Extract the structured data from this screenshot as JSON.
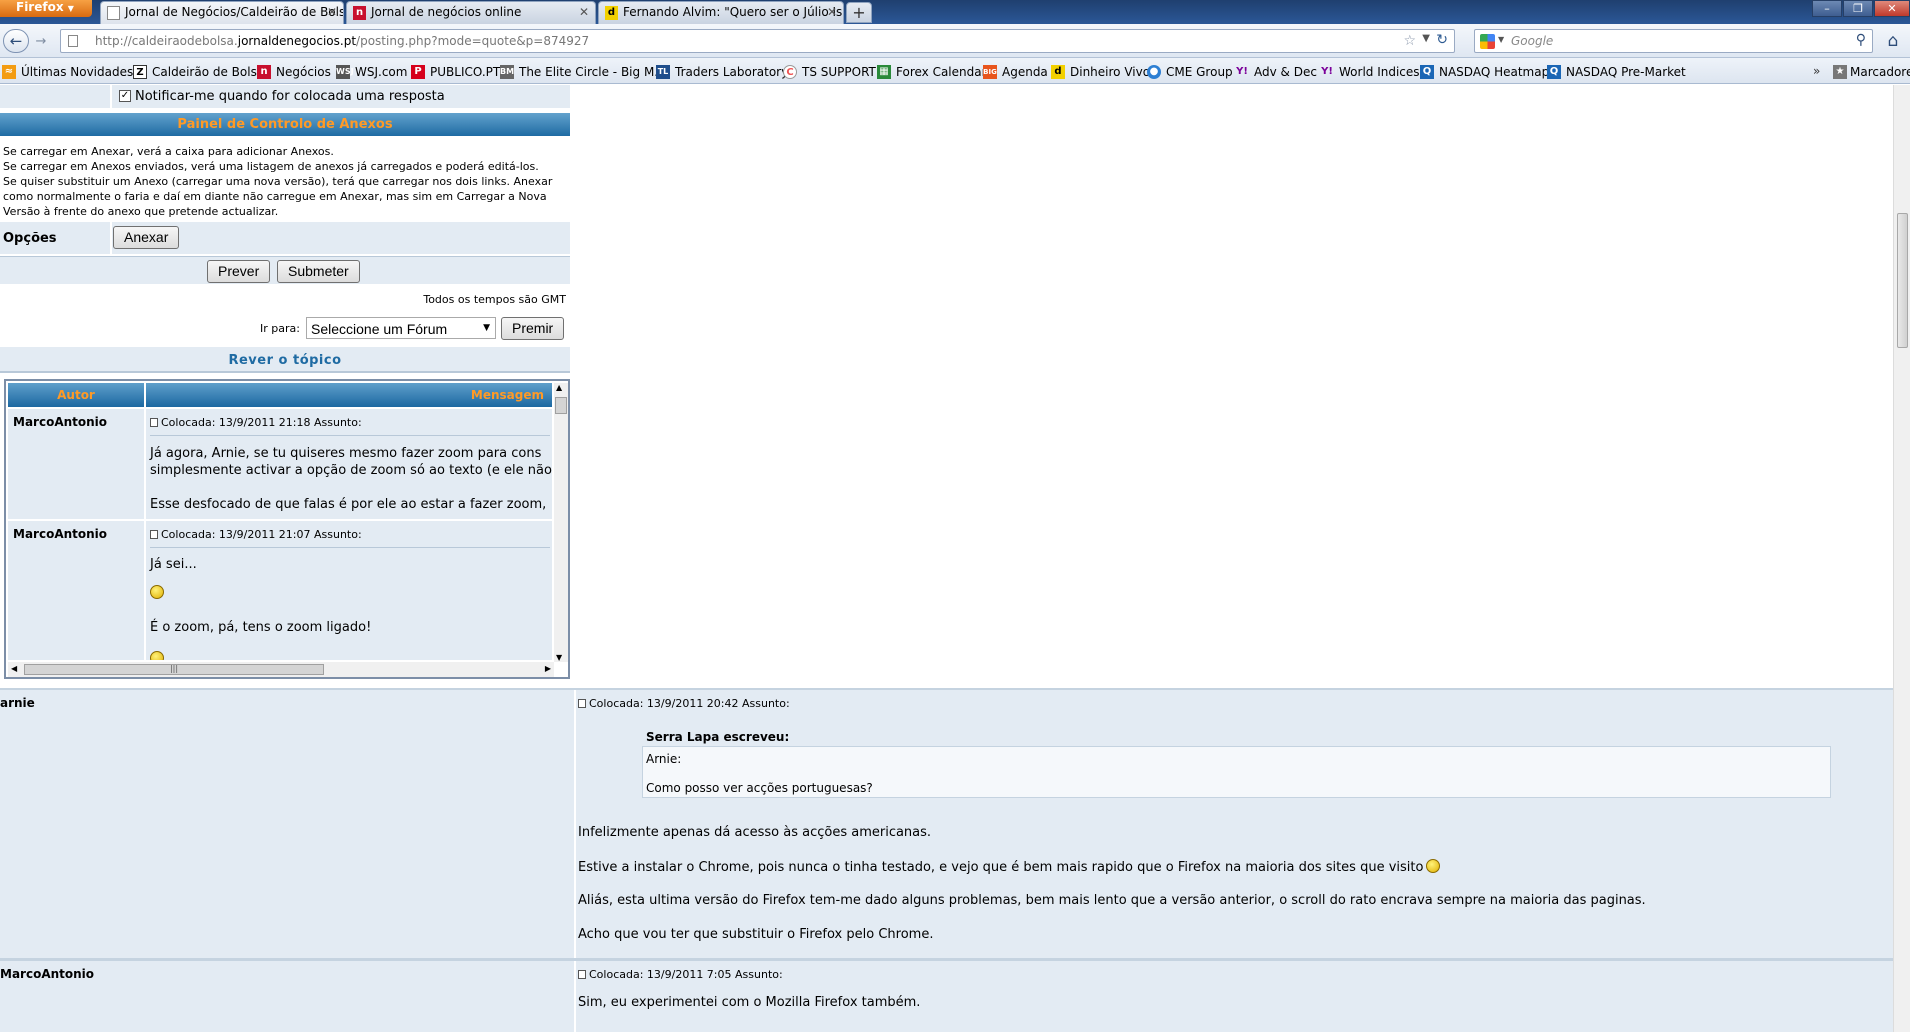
{
  "browser": {
    "app_button": "Firefox",
    "tabs": [
      {
        "title": "Jornal de Negócios/Caldeirão de Bolsa",
        "active": true
      },
      {
        "title": "Jornal de negócios online",
        "active": false
      },
      {
        "title": "Fernando Alvim: \"Quero ser o Júlio Isi...",
        "active": false
      }
    ],
    "url_prefix": "http://caldeiraodebolsa.",
    "url_domain": "jornaldenegocios.pt",
    "url_path": "/posting.php?mode=quote&p=874927",
    "search_placeholder": "Google",
    "bookmarks": [
      "Últimas Novidades",
      "Caldeirão de Bolsa",
      "Negócios",
      "WSJ.com",
      "PUBLICO.PT",
      "The Elite Circle - Big M...",
      "Traders Laboratory",
      "TS SUPPORT",
      "Forex Calendar",
      "Agenda",
      "Dinheiro Vivo",
      "CME Group",
      "Adv & Dec",
      "World Indices",
      "NASDAQ Heatmap",
      "NASDAQ Pre-Market"
    ],
    "bookmarks_more": "»",
    "bookmarks_folder": "Marcadores"
  },
  "form": {
    "notify_label": "Notificar-me quando for colocada uma resposta",
    "attach_panel_title": "Painel de Controlo de Anexos",
    "attach_help": [
      "Se carregar em Anexar, verá a caixa para adicionar Anexos.",
      "Se carregar em Anexos enviados, verá uma listagem de anexos já carregados e poderá editá-los.",
      "Se quiser substituir um Anexo (carregar uma nova versão), terá que carregar nos dois links. Anexar",
      "como normalmente o faria e daí em diante não carregue em Anexar, mas sim em Carregar a Nova",
      "Versão à frente do anexo que pretende actualizar."
    ],
    "options_label": "Opções",
    "attach_button": "Anexar",
    "preview_button": "Prever",
    "submit_button": "Submeter",
    "timezone_note": "Todos os tempos são GMT",
    "jump_label": "Ir para:",
    "jump_select_value": "Seleccione um Fórum",
    "jump_button": "Premir"
  },
  "review": {
    "title": "Rever o tópico",
    "col_author": "Autor",
    "col_message": "Mensagem",
    "posts": [
      {
        "author": "MarcoAntonio",
        "meta": "Colocada: 13/9/2011 21:18    Assunto:",
        "lines": [
          "Já agora, Arnie, se tu quiseres mesmo fazer zoom para cons",
          "simplesmente activar a opção de zoom só ao texto (e ele não",
          "Esse desfocado de que falas é por ele ao estar a fazer zoom,"
        ]
      },
      {
        "author": "MarcoAntonio",
        "meta": "Colocada: 13/9/2011 21:07    Assunto:",
        "lines": [
          "Já sei...",
          "É o zoom, pá, tens o zoom ligado!"
        ]
      }
    ]
  },
  "thread": {
    "posts": [
      {
        "author": "arnie",
        "meta": "Colocada: 13/9/2011 20:42    Assunto:",
        "quote_author": "Serra Lapa escreveu:",
        "quote_lines": [
          "Arnie:",
          "Como posso ver acções portuguesas?"
        ],
        "lines": [
          "Infelizmente apenas dá acesso às acções americanas.",
          "Estive a instalar o Chrome, pois nunca o tinha testado, e vejo que é bem mais rapido que o Firefox na maioria dos sites que visito",
          "Aliás, esta ultima versão do Firefox tem-me dado alguns problemas, bem mais lento que a versão anterior, o scroll do rato encrava sempre na maioria das paginas.",
          "Acho que vou ter que substituir o Firefox pelo Chrome."
        ]
      },
      {
        "author": "MarcoAntonio",
        "meta": "Colocada: 13/9/2011 7:05    Assunto:",
        "lines": [
          "Sim, eu experimentei com o Mozilla Firefox também."
        ]
      }
    ]
  },
  "colors": {
    "header_blue": "#1f6ba3",
    "header_text_orange": "#ff9a26",
    "row_light": "#e3ebf3"
  }
}
